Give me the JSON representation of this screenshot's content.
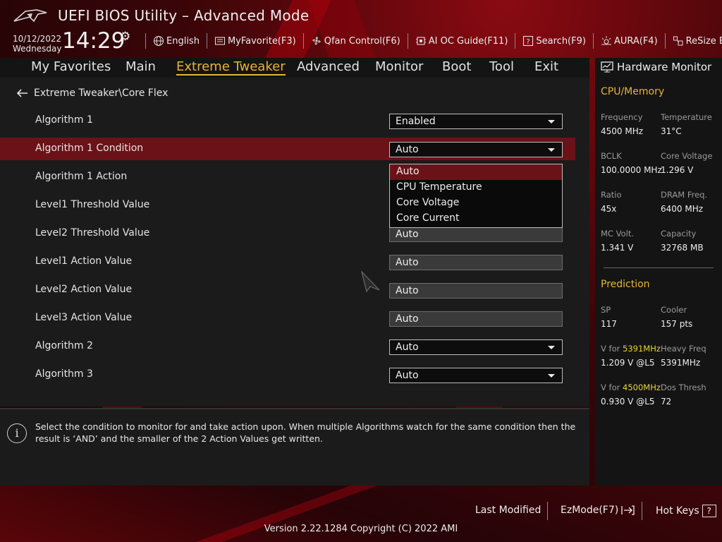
{
  "header": {
    "app_title": "UEFI BIOS Utility – Advanced Mode",
    "date": "10/12/2022",
    "weekday": "Wednesday",
    "time": "14:29",
    "tools": [
      {
        "label": "English",
        "icon": "globe-icon"
      },
      {
        "label": "MyFavorite(F3)",
        "icon": "favorite-icon"
      },
      {
        "label": "Qfan Control(F6)",
        "icon": "fan-icon"
      },
      {
        "label": "AI OC Guide(F11)",
        "icon": "ai-oc-icon"
      },
      {
        "label": "Search(F9)",
        "icon": "search-help-icon"
      },
      {
        "label": "AURA(F4)",
        "icon": "aura-icon"
      },
      {
        "label": "ReSize BAR",
        "icon": "resize-bar-icon"
      }
    ]
  },
  "menu": {
    "items": [
      "My Favorites",
      "Main",
      "Extreme Tweaker",
      "Advanced",
      "Monitor",
      "Boot",
      "Tool",
      "Exit"
    ],
    "active": "Extreme Tweaker"
  },
  "main": {
    "breadcrumb": "Extreme Tweaker\\Core Flex",
    "rows": [
      {
        "label": "Algorithm 1",
        "value": "Enabled",
        "type": "dropdown"
      },
      {
        "label": "Algorithm 1 Condition",
        "value": "Auto",
        "type": "dropdown"
      },
      {
        "label": "Algorithm 1 Action",
        "value": "",
        "type": "hidden"
      },
      {
        "label": "Level1 Threshold Value",
        "value": "",
        "type": "hidden"
      },
      {
        "label": "Level2 Threshold Value",
        "value": "Auto",
        "type": "text"
      },
      {
        "label": "Level1 Action Value",
        "value": "Auto",
        "type": "text"
      },
      {
        "label": "Level2 Action Value",
        "value": "Auto",
        "type": "text"
      },
      {
        "label": "Level3 Action Value",
        "value": "Auto",
        "type": "text"
      },
      {
        "label": "Algorithm 2",
        "value": "Auto",
        "type": "dropdown"
      },
      {
        "label": "Algorithm 3",
        "value": "Auto",
        "type": "dropdown"
      }
    ],
    "dropdown_options": [
      "Auto",
      "CPU Temperature",
      "Core Voltage",
      "Core Current"
    ],
    "dropdown_selected": "Auto"
  },
  "help": {
    "text": "Select the condition to monitor for and take action upon. When multiple Algorithms watch for the same condition then the result is ‘AND’ and the smaller of the 2 Action Values get written."
  },
  "hardware_monitor": {
    "title": "Hardware Monitor",
    "cpu_memory": {
      "title": "CPU/Memory",
      "items": [
        {
          "label": "Frequency",
          "value": "4500 MHz"
        },
        {
          "label": "Temperature",
          "value": "31°C"
        },
        {
          "label": "BCLK",
          "value": "100.0000 MHz"
        },
        {
          "label": "Core Voltage",
          "value": "1.296 V"
        },
        {
          "label": "Ratio",
          "value": "45x"
        },
        {
          "label": "DRAM Freq.",
          "value": "6400 MHz"
        },
        {
          "label": "MC Volt.",
          "value": "1.341 V"
        },
        {
          "label": "Capacity",
          "value": "32768 MB"
        }
      ]
    },
    "prediction": {
      "title": "Prediction",
      "sp_label": "SP",
      "sp_value": "117",
      "cooler_label": "Cooler",
      "cooler_value": "157 pts",
      "v1_prefix": "V for ",
      "v1_freq": "5391MHz",
      "v1_value": "1.209 V @L5",
      "heavy_label": "Heavy Freq",
      "heavy_value": "5391MHz",
      "v2_prefix": "V for ",
      "v2_freq": "4500MHz",
      "v2_value": "0.930 V @L5",
      "dos_label": "Dos Thresh",
      "dos_value": "72"
    }
  },
  "footer": {
    "last_modified": "Last Modified",
    "ezmode": "EzMode(F7)",
    "hotkeys": "Hot Keys",
    "hotkeys_key": "?",
    "version": "Version 2.22.1284 Copyright (C) 2022 AMI"
  },
  "colors": {
    "accent": "#e9b338",
    "selection": "#6b1218",
    "highlight": "#e9d338"
  }
}
